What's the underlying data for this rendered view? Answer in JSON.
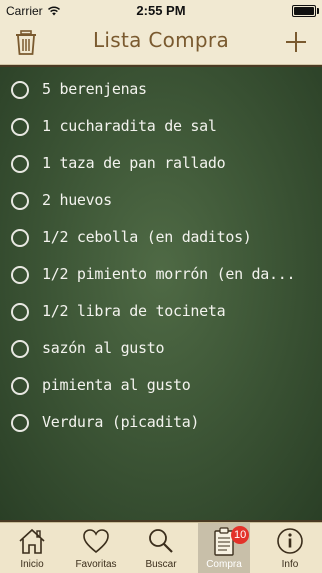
{
  "status_bar": {
    "carrier": "Carrier",
    "time": "2:55 PM"
  },
  "nav": {
    "title": "Lista Compra"
  },
  "shopping_list": [
    {
      "label": "5 berenjenas"
    },
    {
      "label": "1 cucharadita de sal"
    },
    {
      "label": "1 taza de pan rallado"
    },
    {
      "label": "2 huevos"
    },
    {
      "label": "1/2 cebolla (en daditos)"
    },
    {
      "label": "1/2 pimiento morrón (en da..."
    },
    {
      "label": "1/2 libra de tocineta"
    },
    {
      "label": "sazón al gusto"
    },
    {
      "label": "pimienta al gusto"
    },
    {
      "label": "Verdura (picadita)"
    }
  ],
  "tabs": [
    {
      "label": "Inicio",
      "icon": "home-icon"
    },
    {
      "label": "Favoritas",
      "icon": "heart-icon"
    },
    {
      "label": "Buscar",
      "icon": "search-icon"
    },
    {
      "label": "Compra",
      "icon": "list-icon",
      "badge": "10",
      "active": true
    },
    {
      "label": "Info",
      "icon": "info-icon"
    }
  ],
  "colors": {
    "title": "#7a5a2f",
    "board": "#3e5737",
    "badge": "#e3322a",
    "bar": "#f1e9d2"
  }
}
